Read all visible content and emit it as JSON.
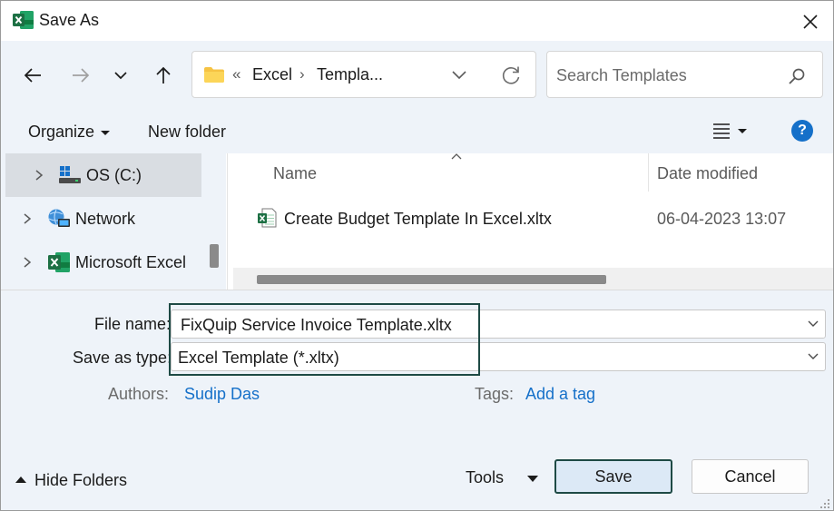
{
  "window": {
    "title": "Save As"
  },
  "nav": {
    "breadcrumb_prefix": "«",
    "breadcrumb": [
      "Excel",
      "Templa..."
    ],
    "search_placeholder": "Search Templates"
  },
  "toolbar": {
    "organize_label": "Organize",
    "new_folder_label": "New folder",
    "help_label": "?"
  },
  "sidebar": {
    "items": [
      {
        "label": "OS (C:)",
        "icon": "drive-icon",
        "selected": true
      },
      {
        "label": "Network",
        "icon": "network-icon",
        "selected": false
      },
      {
        "label": "Microsoft Excel",
        "icon": "excel-icon",
        "selected": false
      }
    ]
  },
  "files": {
    "columns": {
      "name": "Name",
      "date": "Date modified"
    },
    "rows": [
      {
        "name": "Create Budget Template In Excel.xltx",
        "date": "06-04-2023 13:07",
        "icon": "excel-template-icon"
      }
    ]
  },
  "form": {
    "file_name_label": "File name:",
    "file_name_value": "FixQuip Service Invoice Template.xltx",
    "save_type_label": "Save as type:",
    "save_type_value": "Excel Template (*.xltx)",
    "authors_label": "Authors:",
    "authors_value": "Sudip Das",
    "tags_label": "Tags:",
    "tags_value": "Add a tag"
  },
  "footer": {
    "hide_folders_label": "Hide Folders",
    "tools_label": "Tools",
    "save_label": "Save",
    "cancel_label": "Cancel"
  },
  "colors": {
    "accent": "#1570c9",
    "highlight_border": "#1e4a45",
    "excel_green": "#1d7044",
    "pane_background": "#eef3f9"
  }
}
